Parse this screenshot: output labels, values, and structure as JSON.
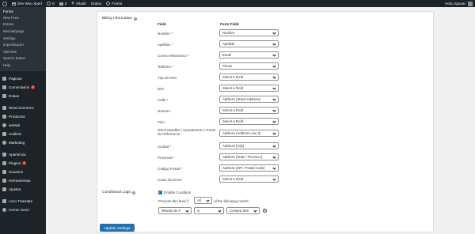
{
  "adminbar": {
    "site_name": "Dev Woo Xpert",
    "updates_count": "6",
    "comments_count": "3",
    "new_label": "Añadir",
    "dokan_label": "Dokan",
    "forms_label": "Forms",
    "greeting": "Hola, kpavar"
  },
  "sidebar": {
    "submenu_head": "Forms",
    "submenu_items": [
      "New Form",
      "Entries",
      "Mercadopago",
      "Settings",
      "Import/Export",
      "Add-Ons",
      "System Status",
      "Help"
    ],
    "menu": [
      {
        "label": "Páginas",
        "icon": "pages-icon"
      },
      {
        "label": "Comentarios",
        "icon": "comments-icon",
        "badge": "3"
      },
      {
        "label": "Dokan",
        "icon": "dokan-icon"
      },
      {
        "label": "WooCommerce",
        "icon": "woocommerce-icon"
      },
      {
        "label": "Productos",
        "icon": "products-icon"
      },
      {
        "label": "weMail",
        "icon": "wemail-icon"
      },
      {
        "label": "Análisis",
        "icon": "analytics-icon"
      },
      {
        "label": "Marketing",
        "icon": "marketing-icon"
      },
      {
        "label": "Apariencia",
        "icon": "appearance-icon"
      },
      {
        "label": "Plugins",
        "icon": "plugins-icon",
        "badge": "3"
      },
      {
        "label": "Usuarios",
        "icon": "users-icon"
      },
      {
        "label": "Herramientas",
        "icon": "tools-icon"
      },
      {
        "label": "Ajustes",
        "icon": "settings-icon"
      },
      {
        "label": "Loco Translate",
        "icon": "loco-icon"
      },
      {
        "label": "Cerrar menú",
        "icon": "collapse-icon"
      }
    ]
  },
  "billing": {
    "label": "Billing Information",
    "col_field": "Field",
    "col_form_field": "Form Field",
    "rows": [
      {
        "label": "Nombre *",
        "value": "Nombre"
      },
      {
        "label": "Apellido *",
        "value": "Apellido"
      },
      {
        "label": "Correo electrónico *",
        "value": "Email"
      },
      {
        "label": "Teléfono *",
        "value": "Phone"
      },
      {
        "label": "Tipo de DNI",
        "value": "Select a Field"
      },
      {
        "label": "DNI",
        "value": "Select a Field"
      },
      {
        "label": "Calle *",
        "value": "Address (Street Address)"
      },
      {
        "label": "Número",
        "value": "Select a Field"
      },
      {
        "label": "Piso",
        "value": "Select a Field"
      },
      {
        "label": "Otros Detalles / Apartamento / Punto de Referencia",
        "value": "Address (Address Line 2)"
      },
      {
        "label": "Ciudad *",
        "value": "Address (City)"
      },
      {
        "label": "Provincia *",
        "value": "Address (State / Province)"
      },
      {
        "label": "Código Postal *",
        "value": "Address (ZIP / Postal Code)"
      },
      {
        "label": "Costo de Envío",
        "value": "Select a Field"
      }
    ]
  },
  "conditional": {
    "label": "Conditional Logic",
    "enable_label": "Enable Condition",
    "process_prefix": "Process this feed if",
    "process_select": "All",
    "process_suffix": "of the following match:",
    "rule_field": "Metodo de P",
    "rule_operator": "is",
    "rule_value": "Compra Dire",
    "add_symbol": "+"
  },
  "update_button": "Update Settings",
  "colors": {
    "primary": "#2271b1",
    "adminbar": "#1d2327",
    "badge": "#d63638"
  }
}
